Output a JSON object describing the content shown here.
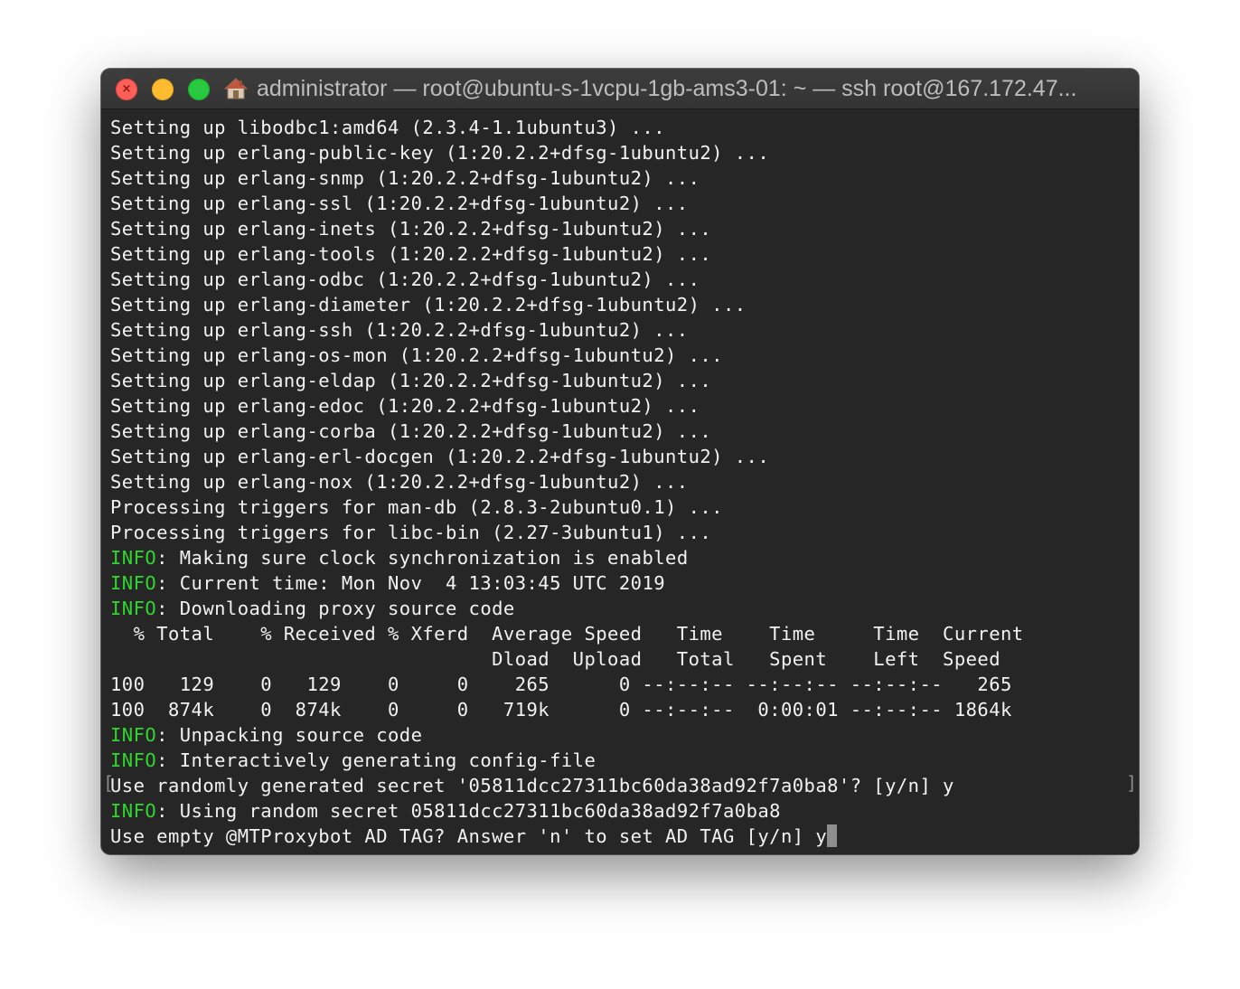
{
  "window": {
    "title": "administrator — root@ubuntu-s-1vcpu-1gb-ams3-01: ~ — ssh root@167.172.47...",
    "icon": "home-icon",
    "controls": {
      "close": "close-icon",
      "minimize": "minimize-icon",
      "maximize": "maximize-icon"
    }
  },
  "colors": {
    "background": "#262626",
    "text": "#f2f2f2",
    "info": "#2ed62e",
    "close": "#fe5f57",
    "minimize": "#febc2e",
    "maximize": "#28c840"
  },
  "terminal": {
    "lines": [
      {
        "tag": "",
        "text": "Setting up libodbc1:amd64 (2.3.4-1.1ubuntu3) ..."
      },
      {
        "tag": "",
        "text": "Setting up erlang-public-key (1:20.2.2+dfsg-1ubuntu2) ..."
      },
      {
        "tag": "",
        "text": "Setting up erlang-snmp (1:20.2.2+dfsg-1ubuntu2) ..."
      },
      {
        "tag": "",
        "text": "Setting up erlang-ssl (1:20.2.2+dfsg-1ubuntu2) ..."
      },
      {
        "tag": "",
        "text": "Setting up erlang-inets (1:20.2.2+dfsg-1ubuntu2) ..."
      },
      {
        "tag": "",
        "text": "Setting up erlang-tools (1:20.2.2+dfsg-1ubuntu2) ..."
      },
      {
        "tag": "",
        "text": "Setting up erlang-odbc (1:20.2.2+dfsg-1ubuntu2) ..."
      },
      {
        "tag": "",
        "text": "Setting up erlang-diameter (1:20.2.2+dfsg-1ubuntu2) ..."
      },
      {
        "tag": "",
        "text": "Setting up erlang-ssh (1:20.2.2+dfsg-1ubuntu2) ..."
      },
      {
        "tag": "",
        "text": "Setting up erlang-os-mon (1:20.2.2+dfsg-1ubuntu2) ..."
      },
      {
        "tag": "",
        "text": "Setting up erlang-eldap (1:20.2.2+dfsg-1ubuntu2) ..."
      },
      {
        "tag": "",
        "text": "Setting up erlang-edoc (1:20.2.2+dfsg-1ubuntu2) ..."
      },
      {
        "tag": "",
        "text": "Setting up erlang-corba (1:20.2.2+dfsg-1ubuntu2) ..."
      },
      {
        "tag": "",
        "text": "Setting up erlang-erl-docgen (1:20.2.2+dfsg-1ubuntu2) ..."
      },
      {
        "tag": "",
        "text": "Setting up erlang-nox (1:20.2.2+dfsg-1ubuntu2) ..."
      },
      {
        "tag": "",
        "text": "Processing triggers for man-db (2.8.3-2ubuntu0.1) ..."
      },
      {
        "tag": "",
        "text": "Processing triggers for libc-bin (2.27-3ubuntu1) ..."
      },
      {
        "tag": "INFO",
        "text": ": Making sure clock synchronization is enabled"
      },
      {
        "tag": "INFO",
        "text": ": Current time: Mon Nov  4 13:03:45 UTC 2019"
      },
      {
        "tag": "INFO",
        "text": ": Downloading proxy source code"
      },
      {
        "tag": "",
        "text": "  % Total    % Received % Xferd  Average Speed   Time    Time     Time  Current"
      },
      {
        "tag": "",
        "text": "                                 Dload  Upload   Total   Spent    Left  Speed"
      },
      {
        "tag": "",
        "text": "100   129    0   129    0     0    265      0 --:--:-- --:--:-- --:--:--   265"
      },
      {
        "tag": "",
        "text": "100  874k    0  874k    0     0   719k      0 --:--:--  0:00:01 --:--:-- 1864k"
      },
      {
        "tag": "INFO",
        "text": ": Unpacking source code"
      },
      {
        "tag": "INFO",
        "text": ": Interactively generating config-file"
      },
      {
        "tag": "",
        "text": "Use randomly generated secret '05811dcc27311bc60da38ad92f7a0ba8'? [y/n] y"
      },
      {
        "tag": "INFO",
        "text": ": Using random secret 05811dcc27311bc60da38ad92f7a0ba8"
      },
      {
        "tag": "",
        "text": "Use empty @MTProxybot AD TAG? Answer 'n' to set AD TAG [y/n] y"
      }
    ],
    "selection_left": "[",
    "selection_right": "]"
  }
}
